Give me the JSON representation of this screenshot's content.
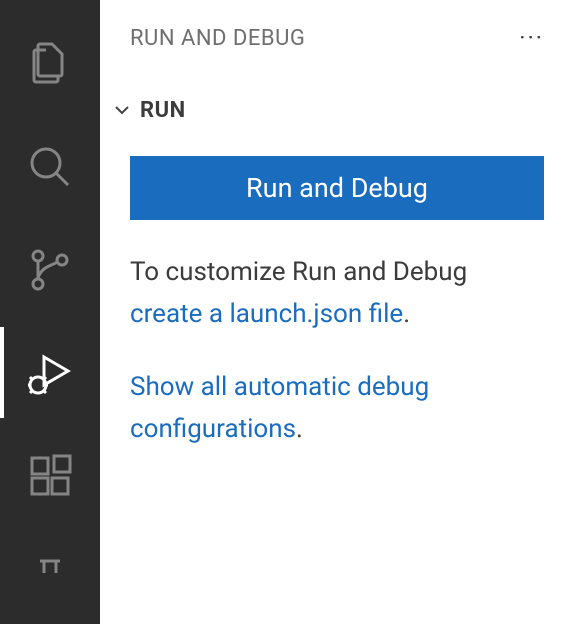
{
  "sidebar": {
    "title": "RUN AND DEBUG",
    "section_title": "RUN"
  },
  "panel": {
    "run_debug_button": "Run and Debug",
    "customize_prefix": "To customize Run and Debug ",
    "create_launch_link": "create a launch.json file",
    "period": ".",
    "show_all_link": "Show all automatic debug configurations",
    "period2": "."
  }
}
